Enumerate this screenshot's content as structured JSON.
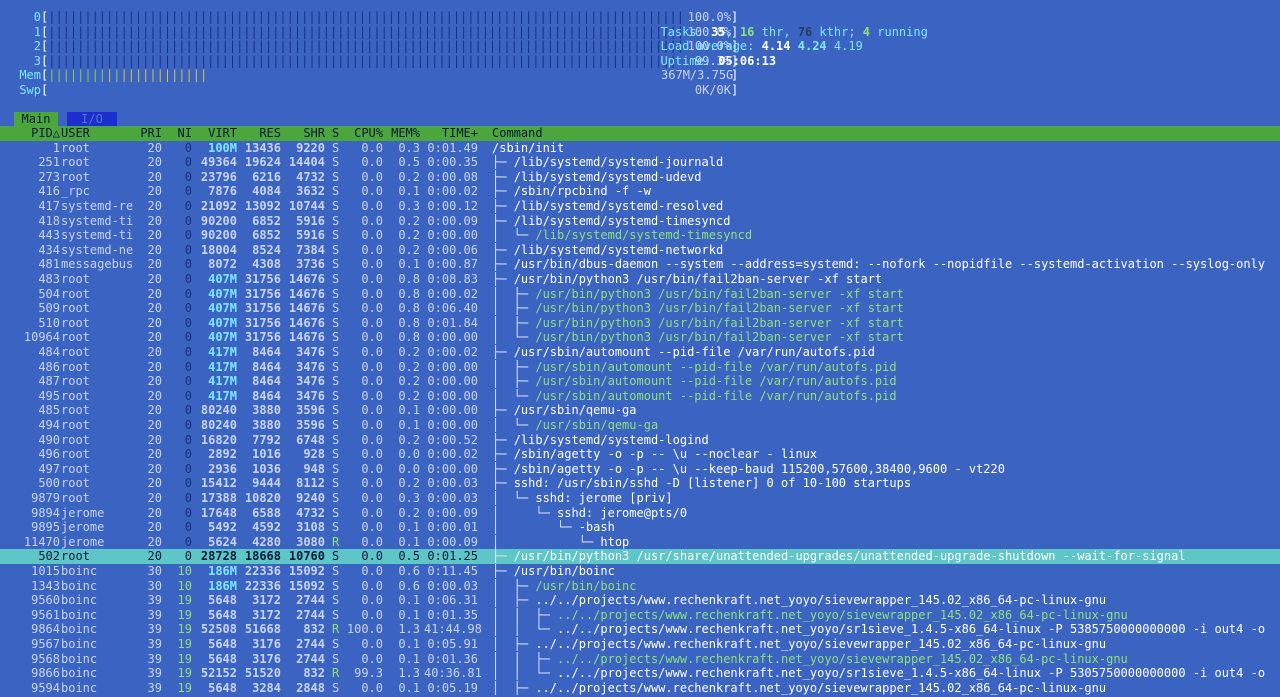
{
  "meters": {
    "cpus": [
      {
        "label": "0",
        "value": "100.0%"
      },
      {
        "label": "1",
        "value": "100.0%"
      },
      {
        "label": "2",
        "value": "100.0%"
      },
      {
        "label": "3",
        "value": "99.3%"
      }
    ],
    "mem": {
      "label": "Mem",
      "value": "367M/3.75G"
    },
    "swp": {
      "label": "Swp",
      "value": "0K/0K"
    }
  },
  "summary": {
    "tasks_label": "Tasks: ",
    "tasks": "35",
    "sep1": ", ",
    "thr": "16",
    "thr_label": " thr, ",
    "kthr": "76",
    "kthr_label": " kthr; ",
    "running": "4",
    "running_label": " running",
    "load_label": "Load average: ",
    "load1": "4.14",
    "load5": "4.24",
    "load15": "4.19",
    "uptime_label": "Uptime: ",
    "uptime": "05:06:13"
  },
  "tabs": {
    "main": "Main",
    "io": "I/O"
  },
  "columns": {
    "pid": "PID△",
    "user": "USER",
    "pri": "PRI",
    "ni": "NI",
    "virt": "VIRT",
    "res": "RES",
    "shr": "SHR",
    "s": "S",
    "cpu": "CPU%",
    "mem": "MEM%",
    "time": "TIME+",
    "command": "Command"
  },
  "processes": [
    {
      "pid": "1",
      "user": "root",
      "pri": "20",
      "ni": "0",
      "virt": "100M",
      "res": "13436",
      "shr": "9220",
      "s": "S",
      "cpu": "0.0",
      "mem": "0.3",
      "time": "0:01.49",
      "tree": "",
      "cmd": "/sbin/init",
      "thread": false
    },
    {
      "pid": "251",
      "user": "root",
      "pri": "20",
      "ni": "0",
      "virt": "49364",
      "res": "19624",
      "shr": "14404",
      "s": "S",
      "cpu": "0.0",
      "mem": "0.5",
      "time": "0:00.35",
      "tree": "├─ ",
      "cmd": "/lib/systemd/systemd-journald",
      "thread": false
    },
    {
      "pid": "273",
      "user": "root",
      "pri": "20",
      "ni": "0",
      "virt": "23796",
      "res": "6216",
      "shr": "4732",
      "s": "S",
      "cpu": "0.0",
      "mem": "0.2",
      "time": "0:00.08",
      "tree": "├─ ",
      "cmd": "/lib/systemd/systemd-udevd",
      "thread": false
    },
    {
      "pid": "416",
      "user": "_rpc",
      "pri": "20",
      "ni": "0",
      "virt": "7876",
      "res": "4084",
      "shr": "3632",
      "s": "S",
      "cpu": "0.0",
      "mem": "0.1",
      "time": "0:00.02",
      "tree": "├─ ",
      "cmd": "/sbin/rpcbind -f -w",
      "thread": false
    },
    {
      "pid": "417",
      "user": "systemd-re",
      "pri": "20",
      "ni": "0",
      "virt": "21092",
      "res": "13092",
      "shr": "10744",
      "s": "S",
      "cpu": "0.0",
      "mem": "0.3",
      "time": "0:00.12",
      "tree": "├─ ",
      "cmd": "/lib/systemd/systemd-resolved",
      "thread": false
    },
    {
      "pid": "418",
      "user": "systemd-ti",
      "pri": "20",
      "ni": "0",
      "virt": "90200",
      "res": "6852",
      "shr": "5916",
      "s": "S",
      "cpu": "0.0",
      "mem": "0.2",
      "time": "0:00.09",
      "tree": "├─ ",
      "cmd": "/lib/systemd/systemd-timesyncd",
      "thread": false
    },
    {
      "pid": "443",
      "user": "systemd-ti",
      "pri": "20",
      "ni": "0",
      "virt": "90200",
      "res": "6852",
      "shr": "5916",
      "s": "S",
      "cpu": "0.0",
      "mem": "0.2",
      "time": "0:00.00",
      "tree": "│  └─ ",
      "cmd": "/lib/systemd/systemd-timesyncd",
      "thread": true
    },
    {
      "pid": "434",
      "user": "systemd-ne",
      "pri": "20",
      "ni": "0",
      "virt": "18004",
      "res": "8524",
      "shr": "7384",
      "s": "S",
      "cpu": "0.0",
      "mem": "0.2",
      "time": "0:00.06",
      "tree": "├─ ",
      "cmd": "/lib/systemd/systemd-networkd",
      "thread": false
    },
    {
      "pid": "481",
      "user": "messagebus",
      "pri": "20",
      "ni": "0",
      "virt": "8072",
      "res": "4308",
      "shr": "3736",
      "s": "S",
      "cpu": "0.0",
      "mem": "0.1",
      "time": "0:00.87",
      "tree": "├─ ",
      "cmd": "/usr/bin/dbus-daemon --system --address=systemd: --nofork --nopidfile --systemd-activation --syslog-only",
      "thread": false
    },
    {
      "pid": "483",
      "user": "root",
      "pri": "20",
      "ni": "0",
      "virt": "407M",
      "res": "31756",
      "shr": "14676",
      "s": "S",
      "cpu": "0.0",
      "mem": "0.8",
      "time": "0:08.83",
      "tree": "├─ ",
      "cmd": "/usr/bin/python3 /usr/bin/fail2ban-server -xf start",
      "thread": false
    },
    {
      "pid": "504",
      "user": "root",
      "pri": "20",
      "ni": "0",
      "virt": "407M",
      "res": "31756",
      "shr": "14676",
      "s": "S",
      "cpu": "0.0",
      "mem": "0.8",
      "time": "0:00.02",
      "tree": "│  ├─ ",
      "cmd": "/usr/bin/python3 /usr/bin/fail2ban-server -xf start",
      "thread": true
    },
    {
      "pid": "509",
      "user": "root",
      "pri": "20",
      "ni": "0",
      "virt": "407M",
      "res": "31756",
      "shr": "14676",
      "s": "S",
      "cpu": "0.0",
      "mem": "0.8",
      "time": "0:06.40",
      "tree": "│  ├─ ",
      "cmd": "/usr/bin/python3 /usr/bin/fail2ban-server -xf start",
      "thread": true
    },
    {
      "pid": "510",
      "user": "root",
      "pri": "20",
      "ni": "0",
      "virt": "407M",
      "res": "31756",
      "shr": "14676",
      "s": "S",
      "cpu": "0.0",
      "mem": "0.8",
      "time": "0:01.84",
      "tree": "│  ├─ ",
      "cmd": "/usr/bin/python3 /usr/bin/fail2ban-server -xf start",
      "thread": true
    },
    {
      "pid": "10964",
      "user": "root",
      "pri": "20",
      "ni": "0",
      "virt": "407M",
      "res": "31756",
      "shr": "14676",
      "s": "S",
      "cpu": "0.0",
      "mem": "0.8",
      "time": "0:00.00",
      "tree": "│  └─ ",
      "cmd": "/usr/bin/python3 /usr/bin/fail2ban-server -xf start",
      "thread": true
    },
    {
      "pid": "484",
      "user": "root",
      "pri": "20",
      "ni": "0",
      "virt": "417M",
      "res": "8464",
      "shr": "3476",
      "s": "S",
      "cpu": "0.0",
      "mem": "0.2",
      "time": "0:00.02",
      "tree": "├─ ",
      "cmd": "/usr/sbin/automount --pid-file /var/run/autofs.pid",
      "thread": false
    },
    {
      "pid": "486",
      "user": "root",
      "pri": "20",
      "ni": "0",
      "virt": "417M",
      "res": "8464",
      "shr": "3476",
      "s": "S",
      "cpu": "0.0",
      "mem": "0.2",
      "time": "0:00.00",
      "tree": "│  ├─ ",
      "cmd": "/usr/sbin/automount --pid-file /var/run/autofs.pid",
      "thread": true
    },
    {
      "pid": "487",
      "user": "root",
      "pri": "20",
      "ni": "0",
      "virt": "417M",
      "res": "8464",
      "shr": "3476",
      "s": "S",
      "cpu": "0.0",
      "mem": "0.2",
      "time": "0:00.00",
      "tree": "│  ├─ ",
      "cmd": "/usr/sbin/automount --pid-file /var/run/autofs.pid",
      "thread": true
    },
    {
      "pid": "495",
      "user": "root",
      "pri": "20",
      "ni": "0",
      "virt": "417M",
      "res": "8464",
      "shr": "3476",
      "s": "S",
      "cpu": "0.0",
      "mem": "0.2",
      "time": "0:00.00",
      "tree": "│  └─ ",
      "cmd": "/usr/sbin/automount --pid-file /var/run/autofs.pid",
      "thread": true
    },
    {
      "pid": "485",
      "user": "root",
      "pri": "20",
      "ni": "0",
      "virt": "80240",
      "res": "3880",
      "shr": "3596",
      "s": "S",
      "cpu": "0.0",
      "mem": "0.1",
      "time": "0:00.00",
      "tree": "├─ ",
      "cmd": "/usr/sbin/qemu-ga",
      "thread": false
    },
    {
      "pid": "494",
      "user": "root",
      "pri": "20",
      "ni": "0",
      "virt": "80240",
      "res": "3880",
      "shr": "3596",
      "s": "S",
      "cpu": "0.0",
      "mem": "0.1",
      "time": "0:00.00",
      "tree": "│  └─ ",
      "cmd": "/usr/sbin/qemu-ga",
      "thread": true
    },
    {
      "pid": "490",
      "user": "root",
      "pri": "20",
      "ni": "0",
      "virt": "16820",
      "res": "7792",
      "shr": "6748",
      "s": "S",
      "cpu": "0.0",
      "mem": "0.2",
      "time": "0:00.52",
      "tree": "├─ ",
      "cmd": "/lib/systemd/systemd-logind",
      "thread": false
    },
    {
      "pid": "496",
      "user": "root",
      "pri": "20",
      "ni": "0",
      "virt": "2892",
      "res": "1016",
      "shr": "928",
      "s": "S",
      "cpu": "0.0",
      "mem": "0.0",
      "time": "0:00.02",
      "tree": "├─ ",
      "cmd": "/sbin/agetty -o -p -- \\u --noclear - linux",
      "thread": false
    },
    {
      "pid": "497",
      "user": "root",
      "pri": "20",
      "ni": "0",
      "virt": "2936",
      "res": "1036",
      "shr": "948",
      "s": "S",
      "cpu": "0.0",
      "mem": "0.0",
      "time": "0:00.00",
      "tree": "├─ ",
      "cmd": "/sbin/agetty -o -p -- \\u --keep-baud 115200,57600,38400,9600 - vt220",
      "thread": false
    },
    {
      "pid": "500",
      "user": "root",
      "pri": "20",
      "ni": "0",
      "virt": "15412",
      "res": "9444",
      "shr": "8112",
      "s": "S",
      "cpu": "0.0",
      "mem": "0.2",
      "time": "0:00.03",
      "tree": "├─ ",
      "cmd": "sshd: /usr/sbin/sshd -D [listener] 0 of 10-100 startups",
      "thread": false
    },
    {
      "pid": "9879",
      "user": "root",
      "pri": "20",
      "ni": "0",
      "virt": "17388",
      "res": "10820",
      "shr": "9240",
      "s": "S",
      "cpu": "0.0",
      "mem": "0.3",
      "time": "0:00.03",
      "tree": "│  └─ ",
      "cmd": "sshd: jerome [priv]",
      "thread": false
    },
    {
      "pid": "9894",
      "user": "jerome",
      "pri": "20",
      "ni": "0",
      "virt": "17648",
      "res": "6588",
      "shr": "4732",
      "s": "S",
      "cpu": "0.0",
      "mem": "0.2",
      "time": "0:00.09",
      "tree": "│     └─ ",
      "cmd": "sshd: jerome@pts/0",
      "thread": false
    },
    {
      "pid": "9895",
      "user": "jerome",
      "pri": "20",
      "ni": "0",
      "virt": "5492",
      "res": "4592",
      "shr": "3108",
      "s": "S",
      "cpu": "0.0",
      "mem": "0.1",
      "time": "0:00.01",
      "tree": "│        └─ ",
      "cmd": "-bash",
      "thread": false
    },
    {
      "pid": "11470",
      "user": "jerome",
      "pri": "20",
      "ni": "0",
      "virt": "5624",
      "res": "4280",
      "shr": "3080",
      "s": "R",
      "cpu": "0.0",
      "mem": "0.1",
      "time": "0:00.09",
      "tree": "│           └─ ",
      "cmd": "htop",
      "thread": false
    },
    {
      "pid": "502",
      "user": "root",
      "pri": "20",
      "ni": "0",
      "virt": "28728",
      "res": "18668",
      "shr": "10760",
      "s": "S",
      "cpu": "0.0",
      "mem": "0.5",
      "time": "0:01.25",
      "tree": "├─ ",
      "cmd": "/usr/bin/python3 /usr/share/unattended-upgrades/unattended-upgrade-shutdown --wait-for-signal",
      "thread": false,
      "selected": true
    },
    {
      "pid": "1015",
      "user": "boinc",
      "pri": "30",
      "ni": "10",
      "virt": "186M",
      "res": "22336",
      "shr": "15092",
      "s": "S",
      "cpu": "0.0",
      "mem": "0.6",
      "time": "0:11.45",
      "tree": "├─ ",
      "cmd": "/usr/bin/boinc",
      "thread": false
    },
    {
      "pid": "1343",
      "user": "boinc",
      "pri": "30",
      "ni": "10",
      "virt": "186M",
      "res": "22336",
      "shr": "15092",
      "s": "S",
      "cpu": "0.0",
      "mem": "0.6",
      "time": "0:00.03",
      "tree": "│  ├─ ",
      "cmd": "/usr/bin/boinc",
      "thread": true
    },
    {
      "pid": "9560",
      "user": "boinc",
      "pri": "39",
      "ni": "19",
      "virt": "5648",
      "res": "3172",
      "shr": "2744",
      "s": "S",
      "cpu": "0.0",
      "mem": "0.1",
      "time": "0:06.31",
      "tree": "│  ├─ ",
      "cmd": "../../projects/www.rechenkraft.net_yoyo/sievewrapper_145.02_x86_64-pc-linux-gnu",
      "thread": false
    },
    {
      "pid": "9561",
      "user": "boinc",
      "pri": "39",
      "ni": "19",
      "virt": "5648",
      "res": "3172",
      "shr": "2744",
      "s": "S",
      "cpu": "0.0",
      "mem": "0.1",
      "time": "0:01.35",
      "tree": "│  │  ├─ ",
      "cmd": "../../projects/www.rechenkraft.net_yoyo/sievewrapper_145.02_x86_64-pc-linux-gnu",
      "thread": true
    },
    {
      "pid": "9864",
      "user": "boinc",
      "pri": "39",
      "ni": "19",
      "virt": "52508",
      "res": "51668",
      "shr": "832",
      "s": "R",
      "cpu": "100.0",
      "mem": "1.3",
      "time": "41:44.98",
      "tree": "│  │  └─ ",
      "cmd": "../../projects/www.rechenkraft.net_yoyo/sr1sieve_1.4.5-x86_64-linux -P 5385750000000000 -i out4 -o",
      "thread": false
    },
    {
      "pid": "9567",
      "user": "boinc",
      "pri": "39",
      "ni": "19",
      "virt": "5648",
      "res": "3176",
      "shr": "2744",
      "s": "S",
      "cpu": "0.0",
      "mem": "0.1",
      "time": "0:05.91",
      "tree": "│  ├─ ",
      "cmd": "../../projects/www.rechenkraft.net_yoyo/sievewrapper_145.02_x86_64-pc-linux-gnu",
      "thread": false
    },
    {
      "pid": "9568",
      "user": "boinc",
      "pri": "39",
      "ni": "19",
      "virt": "5648",
      "res": "3176",
      "shr": "2744",
      "s": "S",
      "cpu": "0.0",
      "mem": "0.1",
      "time": "0:01.36",
      "tree": "│  │  ├─ ",
      "cmd": "../../projects/www.rechenkraft.net_yoyo/sievewrapper_145.02_x86_64-pc-linux-gnu",
      "thread": true
    },
    {
      "pid": "9866",
      "user": "boinc",
      "pri": "39",
      "ni": "19",
      "virt": "52152",
      "res": "51520",
      "shr": "832",
      "s": "R",
      "cpu": "99.3",
      "mem": "1.3",
      "time": "40:36.81",
      "tree": "│  │  └─ ",
      "cmd": "../../projects/www.rechenkraft.net_yoyo/sr1sieve_1.4.5-x86_64-linux -P 5305750000000000 -i out4 -o",
      "thread": false
    },
    {
      "pid": "9594",
      "user": "boinc",
      "pri": "39",
      "ni": "19",
      "virt": "5648",
      "res": "3284",
      "shr": "2848",
      "s": "S",
      "cpu": "0.0",
      "mem": "0.1",
      "time": "0:05.19",
      "tree": "│  ├─ ",
      "cmd": "../../projects/www.rechenkraft.net_yoyo/sievewrapper_145.02_x86_64-pc-linux-gnu",
      "thread": false
    }
  ]
}
